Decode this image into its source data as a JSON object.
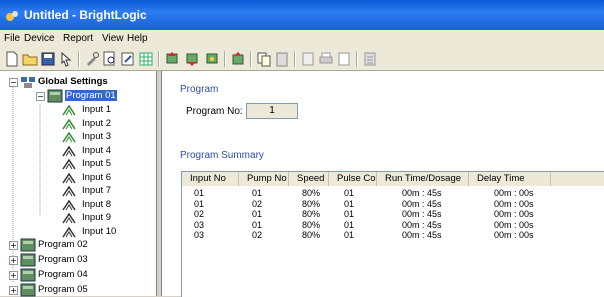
{
  "window": {
    "title": "Untitled - BrightLogic"
  },
  "menu": [
    "File",
    "Device",
    "Report",
    "View",
    "Help"
  ],
  "toolbar_icons": [
    "new-icon",
    "open-icon",
    "save-icon",
    "pointer-icon",
    "tool-icon",
    "preview-icon",
    "edit-icon",
    "grid-icon",
    "device-send-icon",
    "device-receive-icon",
    "device-sync-icon",
    "device-upload-icon",
    "copy-icon",
    "paste-icon",
    "doc-icon",
    "print-icon",
    "blank-icon",
    "calculator-icon"
  ],
  "tree": {
    "root": "Global Settings",
    "programs": [
      {
        "label": "Program 01",
        "selected": true,
        "expanded": true,
        "inputs": [
          "Input 1",
          "Input 2",
          "Input 3",
          "Input 4",
          "Input 5",
          "Input 6",
          "Input 7",
          "Input 8",
          "Input 9",
          "Input 10"
        ]
      },
      {
        "label": "Program 02"
      },
      {
        "label": "Program 03"
      },
      {
        "label": "Program 04"
      },
      {
        "label": "Program 05"
      }
    ]
  },
  "panel": {
    "section_title": "Program",
    "program_no_label": "Program No:",
    "program_no_value": "1",
    "summary_title": "Program Summary"
  },
  "table": {
    "columns": [
      "Input No",
      "Pump No",
      "Speed",
      "Pulse Co...",
      "Run Time/Dosage",
      "Delay Time"
    ],
    "rows": [
      [
        "01",
        "01",
        "80%",
        "01",
        "00m : 45s",
        "00m : 00s"
      ],
      [
        "01",
        "02",
        "80%",
        "01",
        "00m : 45s",
        "00m : 00s"
      ],
      [
        "02",
        "01",
        "80%",
        "01",
        "00m : 45s",
        "00m : 00s"
      ],
      [
        "03",
        "01",
        "80%",
        "01",
        "00m : 45s",
        "00m : 00s"
      ],
      [
        "03",
        "02",
        "80%",
        "01",
        "00m : 45s",
        "00m : 00s"
      ]
    ]
  },
  "colors": {
    "titlebar": "#0a5ad8",
    "selection": "#316ac5",
    "section_title": "#2b4fa5"
  }
}
